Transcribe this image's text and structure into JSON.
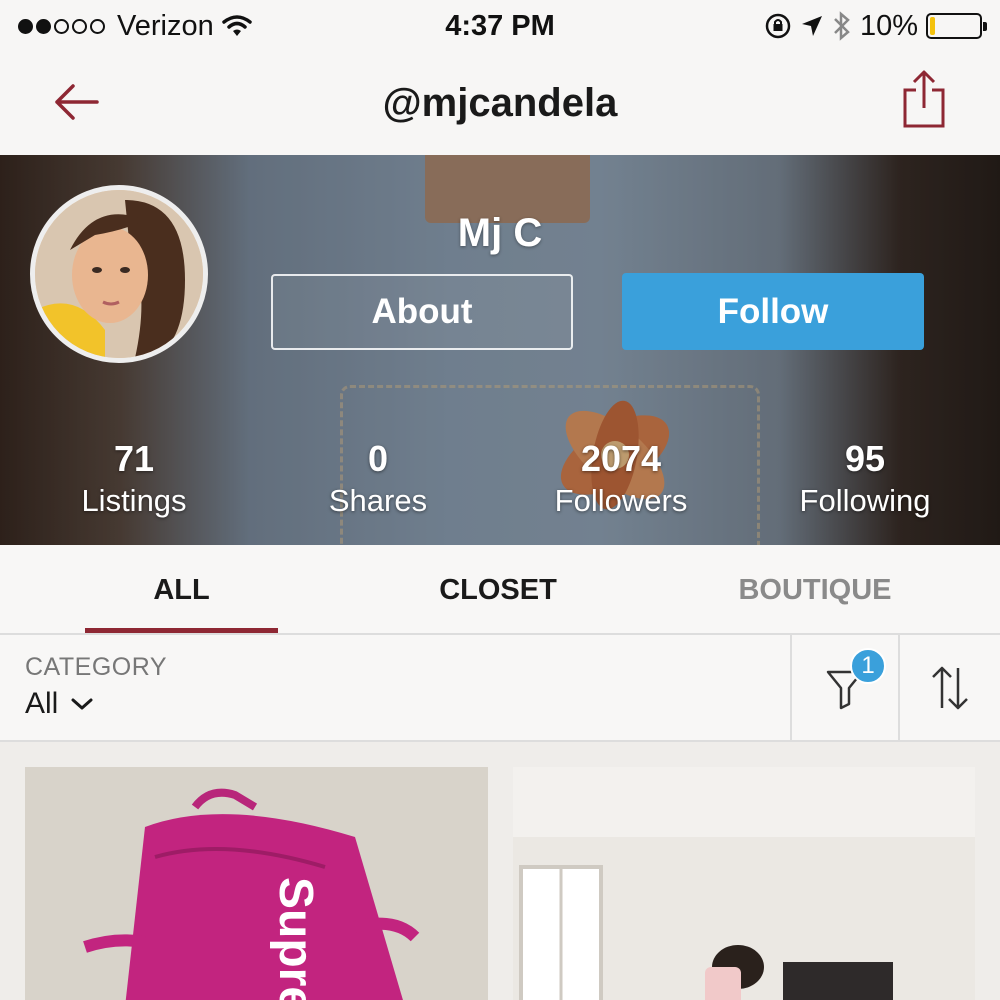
{
  "status_bar": {
    "carrier": "Verizon",
    "time": "4:37 PM",
    "battery": "10%",
    "battery_level": 0.1,
    "signal_bars_filled": 2,
    "signal_bars_total": 5
  },
  "nav": {
    "title": "@mjcandela",
    "back_icon": "back-arrow-icon",
    "share_icon": "share-icon"
  },
  "profile": {
    "display_name": "Mj C",
    "about_label": "About",
    "follow_label": "Follow",
    "stats": [
      {
        "value": "71",
        "label": "Listings"
      },
      {
        "value": "0",
        "label": "Shares"
      },
      {
        "value": "2074",
        "label": "Followers"
      },
      {
        "value": "95",
        "label": "Following"
      }
    ]
  },
  "tabs": [
    {
      "label": "ALL",
      "active": true
    },
    {
      "label": "CLOSET",
      "active": false
    },
    {
      "label": "BOUTIQUE",
      "active": false
    }
  ],
  "filter": {
    "category_label": "CATEGORY",
    "category_value": "All",
    "filter_badge": "1"
  },
  "listings": [
    {
      "image": "pink-backpack",
      "brand_text": "Supre"
    },
    {
      "image": "mirror-selfie-room"
    }
  ],
  "colors": {
    "accent": "#8e2733",
    "follow_blue": "#3aa0db",
    "badge_blue": "#3aa0db",
    "battery_yellow": "#f4c20d"
  }
}
